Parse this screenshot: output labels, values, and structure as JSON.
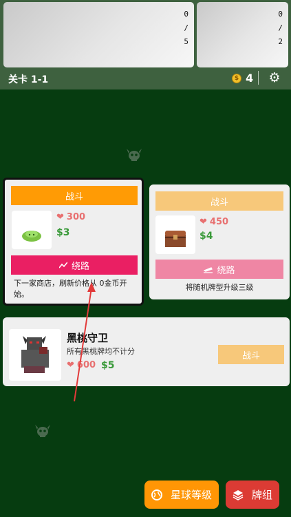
{
  "top": {
    "left_counter": [
      "0",
      "/",
      "5"
    ],
    "right_counter": [
      "0",
      "/",
      "2"
    ],
    "level": "关卡 1-1",
    "coin_symbol": "$",
    "coins": "4"
  },
  "cards": [
    {
      "fight_label": "战斗",
      "hp": "300",
      "money": "$3",
      "detour_label": "绕路",
      "description": "下一家商店，刷新价格从 0金币开始。",
      "selected": true
    },
    {
      "fight_label": "战斗",
      "hp": "450",
      "money": "$4",
      "detour_label": "绕路",
      "description": "将随机牌型升级三级",
      "selected": false
    }
  ],
  "boss": {
    "name": "黑桃守卫",
    "description": "所有黑桃牌均不计分",
    "hp": "600",
    "money": "$5",
    "fight_label": "战斗"
  },
  "bottom": {
    "planet_label": "星球等级",
    "deck_label": "牌组"
  },
  "colors": {
    "background": "#063c10",
    "fight_active": "#ff9b05",
    "fight_inactive": "#f7c87a",
    "detour_active": "#ea1f63",
    "detour_inactive": "#ef86a4",
    "planet_button": "#ff9605",
    "deck_button": "#dc3b34",
    "hp": "#e87070",
    "money": "#3a9a3a"
  },
  "icons": [
    "gear-icon",
    "coin-icon",
    "heart-icon",
    "trend-icon",
    "plane-icon",
    "globe-icon",
    "layers-icon",
    "skull-icon"
  ]
}
